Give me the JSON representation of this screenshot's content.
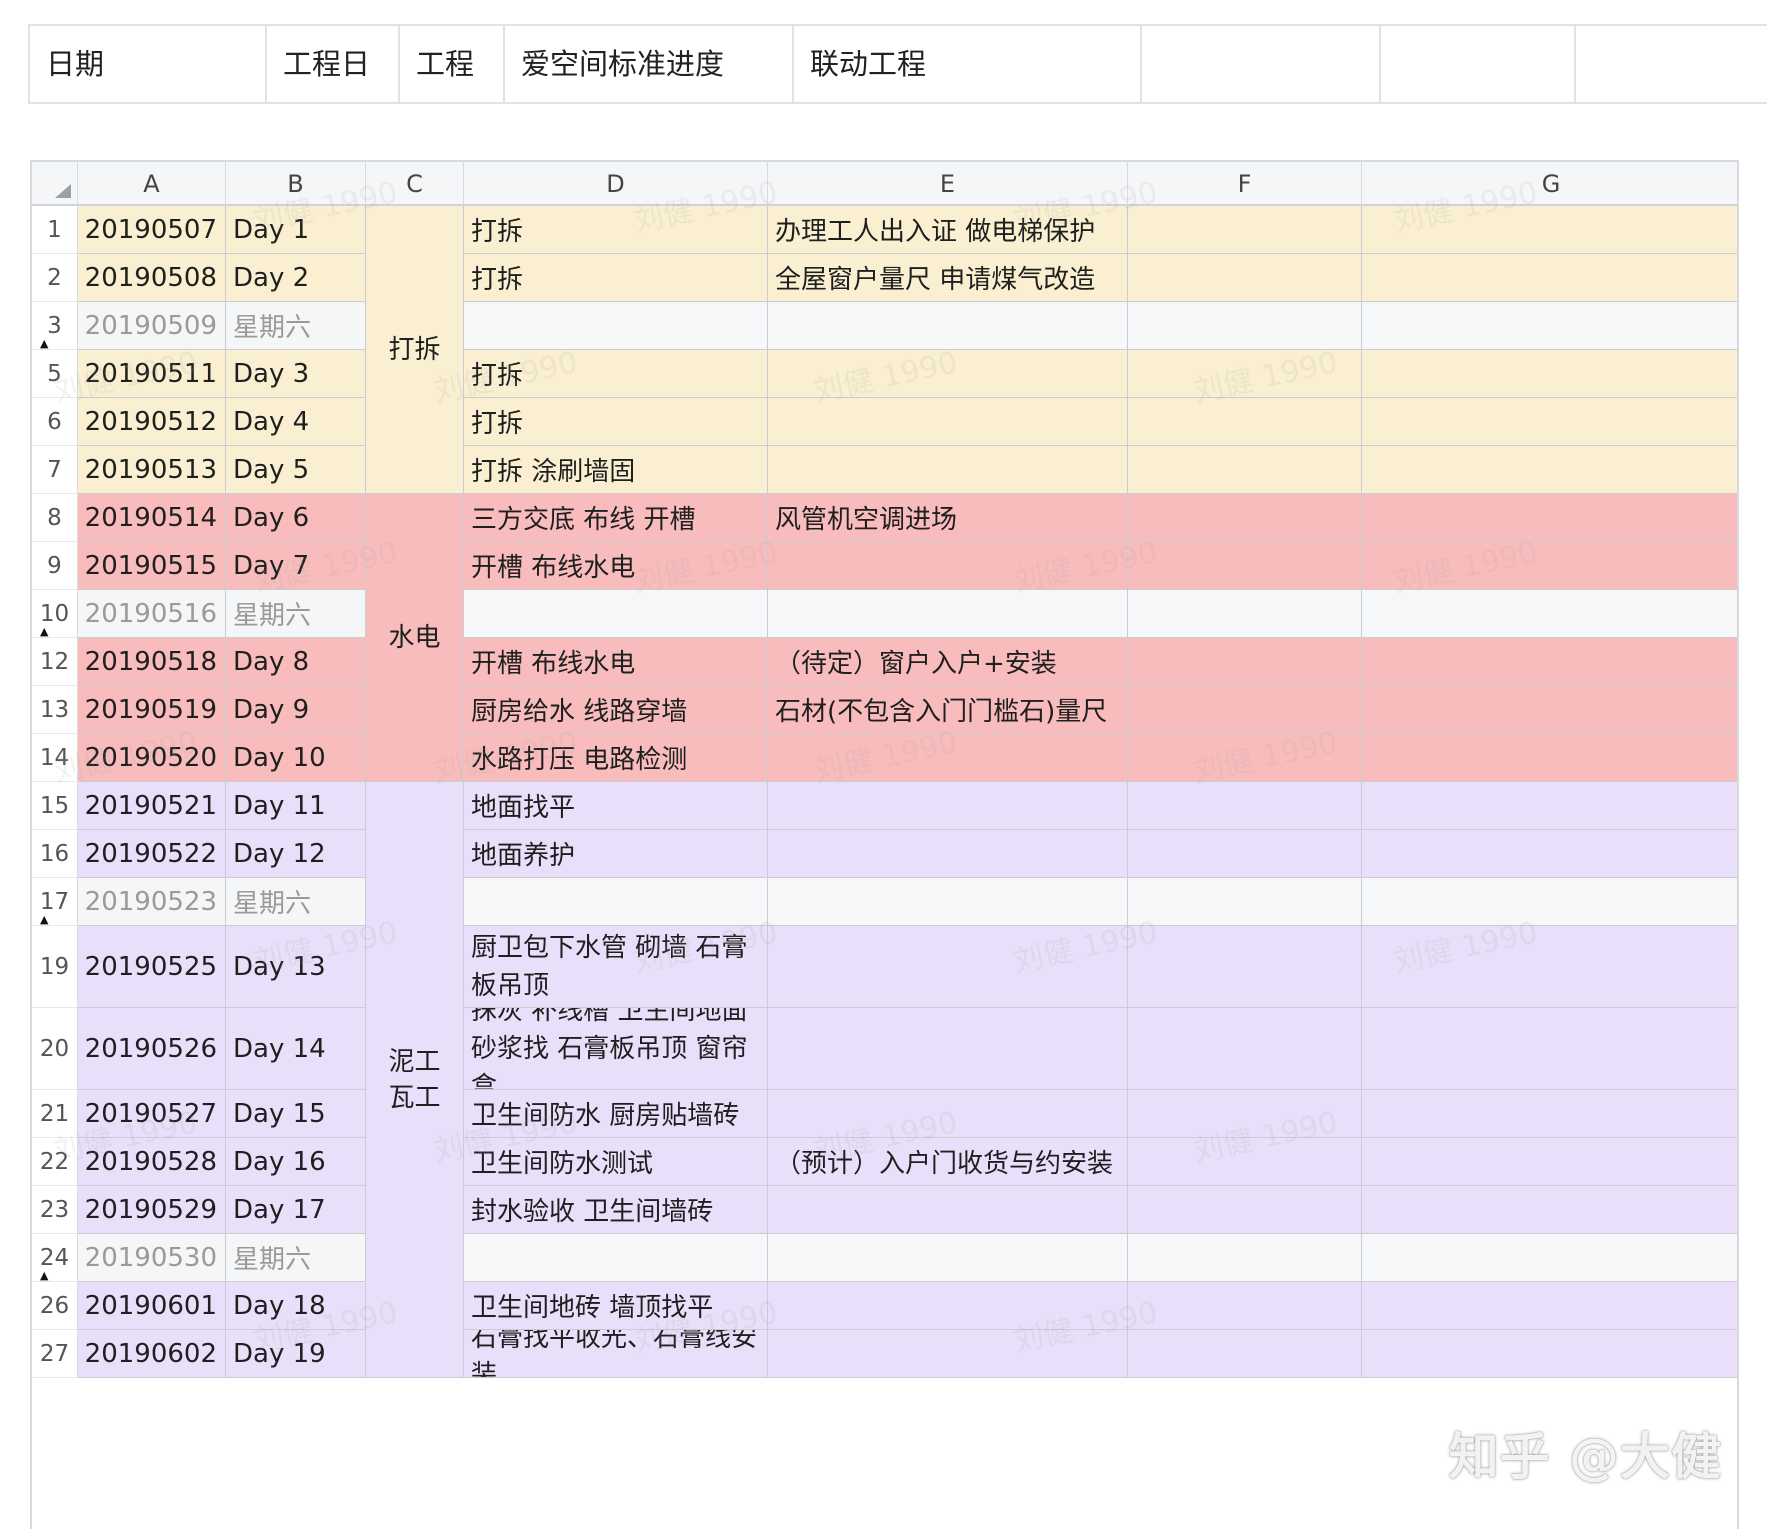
{
  "header": {
    "cells": [
      "日期",
      "工程日",
      "工程",
      "爱空间标准进度",
      "联动工程",
      "",
      ""
    ]
  },
  "sheet": {
    "columns": [
      "A",
      "B",
      "C",
      "D",
      "E",
      "F",
      "G"
    ],
    "watermark": "刘健 1990",
    "colors": {
      "demolition": "#faf0d1",
      "plumbing_electric": "#f8bcbc",
      "masonry": "#e9dffa",
      "weekend": "#f5f6f8"
    },
    "rows": [
      {
        "num": "1",
        "date": "20190507",
        "day": "Day 1",
        "task": "打拆",
        "linked": "办理工人出入证 做电梯保护",
        "phase": "demolition"
      },
      {
        "num": "2",
        "date": "20190508",
        "day": "Day 2",
        "task": "打拆",
        "linked": "全屋窗户量尺 申请煤气改造",
        "phase": "demolition"
      },
      {
        "num": "3",
        "date": "20190509",
        "day": "星期六",
        "task": "",
        "linked": "",
        "phase": "weekend",
        "hidden_after": true
      },
      {
        "num": "5",
        "date": "20190511",
        "day": "Day 3",
        "task": "打拆",
        "linked": "",
        "phase": "demolition"
      },
      {
        "num": "6",
        "date": "20190512",
        "day": "Day 4",
        "task": "打拆",
        "linked": "",
        "phase": "demolition"
      },
      {
        "num": "7",
        "date": "20190513",
        "day": "Day 5",
        "task": "打拆 涂刷墙固",
        "linked": "",
        "phase": "demolition"
      },
      {
        "num": "8",
        "date": "20190514",
        "day": "Day 6",
        "task": "三方交底 布线 开槽",
        "linked": "风管机空调进场",
        "phase": "plumbing_electric"
      },
      {
        "num": "9",
        "date": "20190515",
        "day": "Day 7",
        "task": "开槽 布线水电",
        "linked": "",
        "phase": "plumbing_electric"
      },
      {
        "num": "10",
        "date": "20190516",
        "day": "星期六",
        "task": "",
        "linked": "",
        "phase": "weekend",
        "hidden_after": true
      },
      {
        "num": "12",
        "date": "20190518",
        "day": "Day 8",
        "task": "开槽 布线水电",
        "linked": "（待定）窗户入户+安装",
        "phase": "plumbing_electric"
      },
      {
        "num": "13",
        "date": "20190519",
        "day": "Day 9",
        "task": "厨房给水 线路穿墙",
        "linked": "石材(不包含入门门槛石)量尺",
        "phase": "plumbing_electric"
      },
      {
        "num": "14",
        "date": "20190520",
        "day": "Day 10",
        "task": "水路打压 电路检测",
        "linked": "",
        "phase": "plumbing_electric"
      },
      {
        "num": "15",
        "date": "20190521",
        "day": "Day 11",
        "task": "地面找平",
        "linked": "",
        "phase": "masonry"
      },
      {
        "num": "16",
        "date": "20190522",
        "day": "Day 12",
        "task": "地面养护",
        "linked": "",
        "phase": "masonry"
      },
      {
        "num": "17",
        "date": "20190523",
        "day": "星期六",
        "task": "",
        "linked": "",
        "phase": "weekend",
        "hidden_after": true
      },
      {
        "num": "19",
        "date": "20190525",
        "day": "Day 13",
        "task": "厨卫包下水管  砌墙 石膏板吊顶",
        "linked": "",
        "phase": "masonry",
        "tall": true
      },
      {
        "num": "20",
        "date": "20190526",
        "day": "Day 14",
        "task": "抹灰 补线槽 卫生间地面砂浆找 石膏板吊顶 窗帘盒",
        "linked": "",
        "phase": "masonry",
        "tall": true
      },
      {
        "num": "21",
        "date": "20190527",
        "day": "Day 15",
        "task": "卫生间防水 厨房贴墙砖",
        "linked": "",
        "phase": "masonry"
      },
      {
        "num": "22",
        "date": "20190528",
        "day": "Day 16",
        "task": "卫生间防水测试",
        "linked": "（预计）入户门收货与约安装",
        "phase": "masonry"
      },
      {
        "num": "23",
        "date": "20190529",
        "day": "Day 17",
        "task": "封水验收 卫生间墙砖",
        "linked": "",
        "phase": "masonry"
      },
      {
        "num": "24",
        "date": "20190530",
        "day": "星期六",
        "task": "",
        "linked": "",
        "phase": "weekend",
        "hidden_after": true
      },
      {
        "num": "26",
        "date": "20190601",
        "day": "Day 18",
        "task": "卫生间地砖 墙顶找平",
        "linked": "",
        "phase": "masonry"
      },
      {
        "num": "27",
        "date": "20190602",
        "day": "Day 19",
        "task": "石膏找平收光、石膏线安装",
        "linked": "",
        "phase": "masonry"
      }
    ],
    "phase_groups": [
      {
        "label": "打拆",
        "phase": "demolition",
        "first": 0,
        "last": 5
      },
      {
        "label": "水电",
        "phase": "plumbing_electric",
        "first": 6,
        "last": 11
      },
      {
        "label": "泥工\n瓦工",
        "phase": "masonry",
        "first": 12,
        "last": 22
      }
    ]
  },
  "brand": "知乎 @大健"
}
